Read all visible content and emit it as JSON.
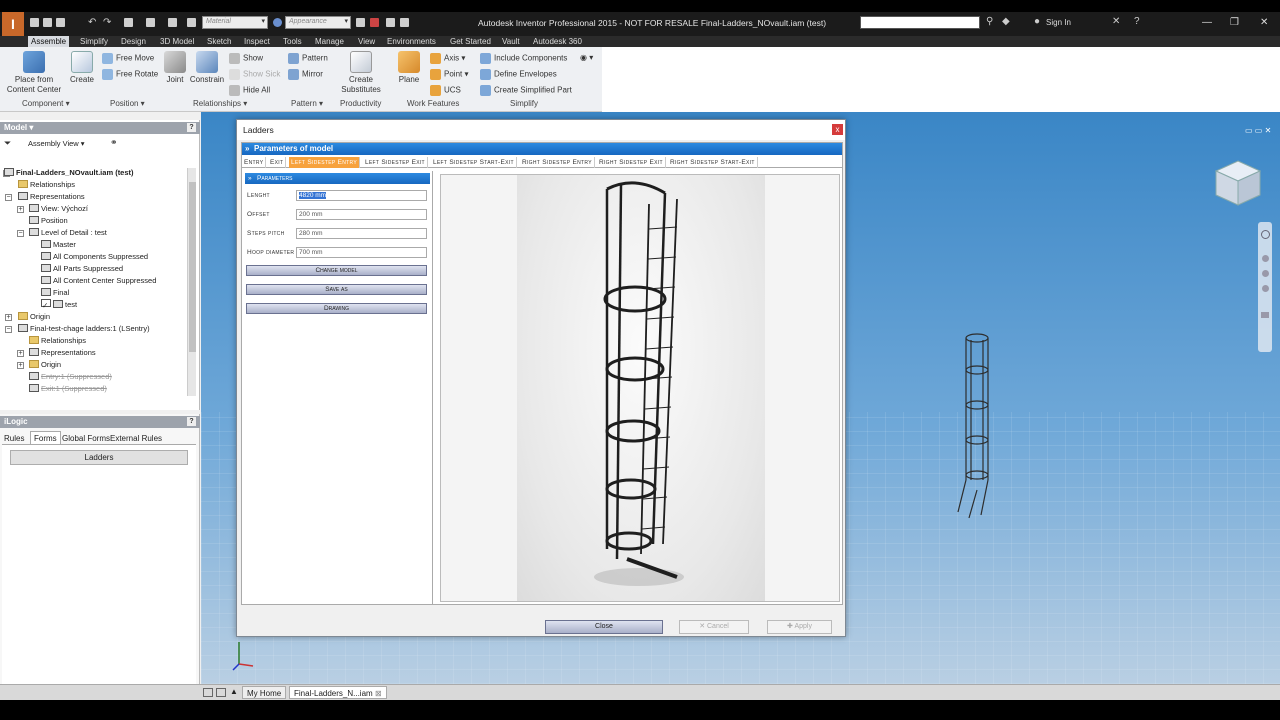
{
  "titlebar": {
    "app_title": "Autodesk Inventor Professional 2015 - NOT FOR RESALE   Final-Ladders_NOvault.iam (test)",
    "material_placeholder": "Material",
    "appearance_placeholder": "Appearance",
    "sign_in": "Sign In"
  },
  "ribbon_tabs": [
    "Assemble",
    "Simplify",
    "Design",
    "3D Model",
    "Sketch",
    "Inspect",
    "Tools",
    "Manage",
    "View",
    "Environments",
    "Get Started",
    "Vault",
    "Autodesk 360"
  ],
  "ribbon": {
    "place_from_content_center": "Place from\nContent Center",
    "place_line1": "Place from",
    "place_line2": "Content Center",
    "create": "Create",
    "free_move": "Free Move",
    "free_rotate": "Free Rotate",
    "joint": "Joint",
    "constrain": "Constrain",
    "show": "Show",
    "show_sick": "Show Sick",
    "hide_all": "Hide All",
    "pattern": "Pattern",
    "mirror": "Mirror",
    "create_substitutes_1": "Create",
    "create_substitutes_2": "Substitutes",
    "plane": "Plane",
    "axis": "Axis",
    "point": "Point",
    "ucs": "UCS",
    "include_components": "Include Components",
    "define_envelopes": "Define Envelopes",
    "create_simplified_part": "Create Simplified Part",
    "groups": {
      "component": "Component ▾",
      "position": "Position ▾",
      "relationships": "Relationships ▾",
      "pattern": "Pattern ▾",
      "productivity": "Productivity",
      "work_features": "Work Features",
      "simplify": "Simplify"
    }
  },
  "model_panel": {
    "title": "Model ▾",
    "view_selector": "Assembly View",
    "tree": {
      "root": "Final-Ladders_NOvault.iam (test)",
      "relationships": "Relationships",
      "representations": "Representations",
      "view": "View: Výchozí",
      "position": "Position",
      "lod": "Level of Detail : test",
      "master": "Master",
      "all_components_suppressed": "All Components Suppressed",
      "all_parts_suppressed": "All Parts Suppressed",
      "all_content_center_suppressed": "All Content Center Suppressed",
      "final": "Final",
      "test": "test",
      "origin": "Origin",
      "sub_assembly": "Final-test-chage ladders:1 (LSentry)",
      "sub_relationships": "Relationships",
      "sub_representations": "Representations",
      "sub_origin": "Origin",
      "entry_suppressed": "Entry:1 (Suppressed)",
      "exit_suppressed": "Exit:1 (Suppressed)"
    }
  },
  "ilogic_panel": {
    "title": "iLogic",
    "tabs": [
      "Rules",
      "Forms",
      "Global Forms",
      "External Rules"
    ],
    "active_tab": "Forms",
    "form_button": "Ladders"
  },
  "dialog": {
    "title": "Ladders",
    "close_glyph": "x",
    "section_title": "Parameters of model",
    "tabs": [
      "Entry",
      "Exit",
      "Left Sidestep Entry",
      "Left Sidestep Exit",
      "Left Sidestep Start-Exit",
      "Right Sidestep Entry",
      "Right Sidestep Exit",
      "Right Sidestep Start-Exit"
    ],
    "active_tab": "Left Sidestep Entry",
    "subsection_title": "Parameters",
    "params": [
      {
        "label": "Lenght",
        "value": "4820 mm"
      },
      {
        "label": "Offset",
        "value": "200 mm"
      },
      {
        "label": "Steps pitch",
        "value": "280 mm"
      },
      {
        "label": "Hoop diameter",
        "value": "700 mm"
      }
    ],
    "buttons": {
      "change_model": "Change model",
      "save_as": "Save as",
      "drawing": "Drawing",
      "close": "Close",
      "cancel": "Cancel",
      "apply": "Apply"
    }
  },
  "statusbar": {
    "my_home": "My Home",
    "doc_tab": "Final-Ladders_N...iam"
  },
  "colors": {
    "accent_blue": "#1b6fcf",
    "active_tab_orange": "#f7a23d",
    "viewport_top": "#3a86c6"
  }
}
